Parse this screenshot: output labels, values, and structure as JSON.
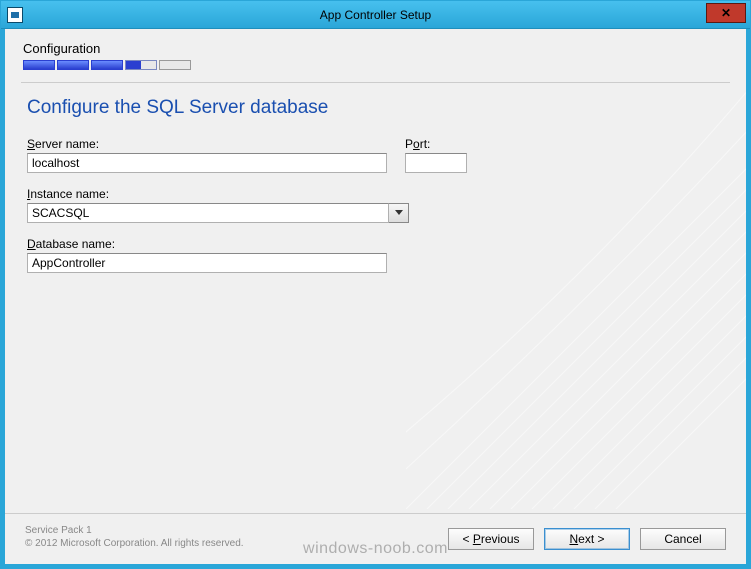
{
  "window": {
    "title": "App Controller Setup"
  },
  "header": {
    "label": "Configuration",
    "progress_total": 5,
    "progress_done": 3
  },
  "page": {
    "heading": "Configure the SQL Server database"
  },
  "fields": {
    "server_label": "Server name:",
    "server_value": "localhost",
    "port_label": "Port:",
    "port_value": "",
    "instance_label": "Instance name:",
    "instance_value": "SCACSQL",
    "database_label": "Database name:",
    "database_value": "AppController"
  },
  "footer": {
    "line1": "Service Pack 1",
    "line2": "© 2012 Microsoft Corporation. All rights reserved.",
    "previous": "< Previous",
    "next": "Next >",
    "cancel": "Cancel"
  },
  "watermark": "windows-noob.com"
}
